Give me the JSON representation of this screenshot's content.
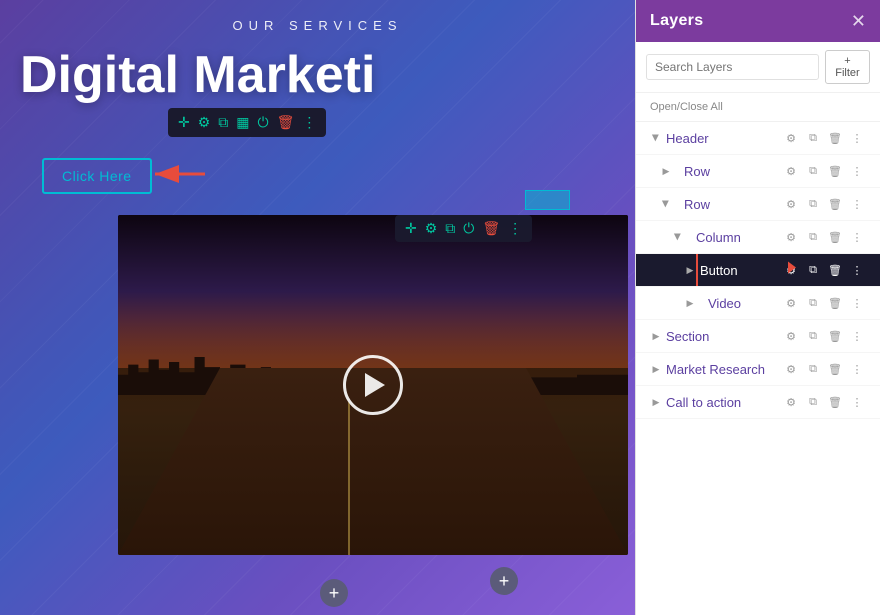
{
  "canvas": {
    "services_label": "OUR SERVICES",
    "heading": "Digital Marketi",
    "click_button": "Click Here"
  },
  "toolbar": {
    "icons": [
      "✛",
      "⚙",
      "⧉",
      "▦",
      "⏻",
      "🗑",
      "⋮"
    ]
  },
  "video_toolbar": {
    "icons": [
      "✛",
      "⚙",
      "⧉",
      "⏻",
      "🗑",
      "⋮"
    ]
  },
  "layers": {
    "panel_title": "Layers",
    "close_icon": "✕",
    "search_placeholder": "Search Layers",
    "filter_label": "+ Filter",
    "open_close_all": "Open/Close All",
    "items": [
      {
        "id": "header",
        "label": "Header",
        "indent": 0,
        "expanded": true,
        "highlighted": false
      },
      {
        "id": "row1",
        "label": "Row",
        "indent": 1,
        "expanded": false,
        "highlighted": false
      },
      {
        "id": "row2",
        "label": "Row",
        "indent": 1,
        "expanded": true,
        "highlighted": false
      },
      {
        "id": "column",
        "label": "Column",
        "indent": 2,
        "expanded": true,
        "highlighted": false
      },
      {
        "id": "button",
        "label": "Button",
        "indent": 3,
        "expanded": false,
        "highlighted": true
      },
      {
        "id": "video",
        "label": "Video",
        "indent": 3,
        "expanded": false,
        "highlighted": false
      },
      {
        "id": "section",
        "label": "Section",
        "indent": 0,
        "expanded": false,
        "highlighted": false
      },
      {
        "id": "market-research",
        "label": "Market Research",
        "indent": 0,
        "expanded": false,
        "highlighted": false
      },
      {
        "id": "call-to-action",
        "label": "Call to action",
        "indent": 0,
        "expanded": false,
        "highlighted": false
      }
    ]
  }
}
